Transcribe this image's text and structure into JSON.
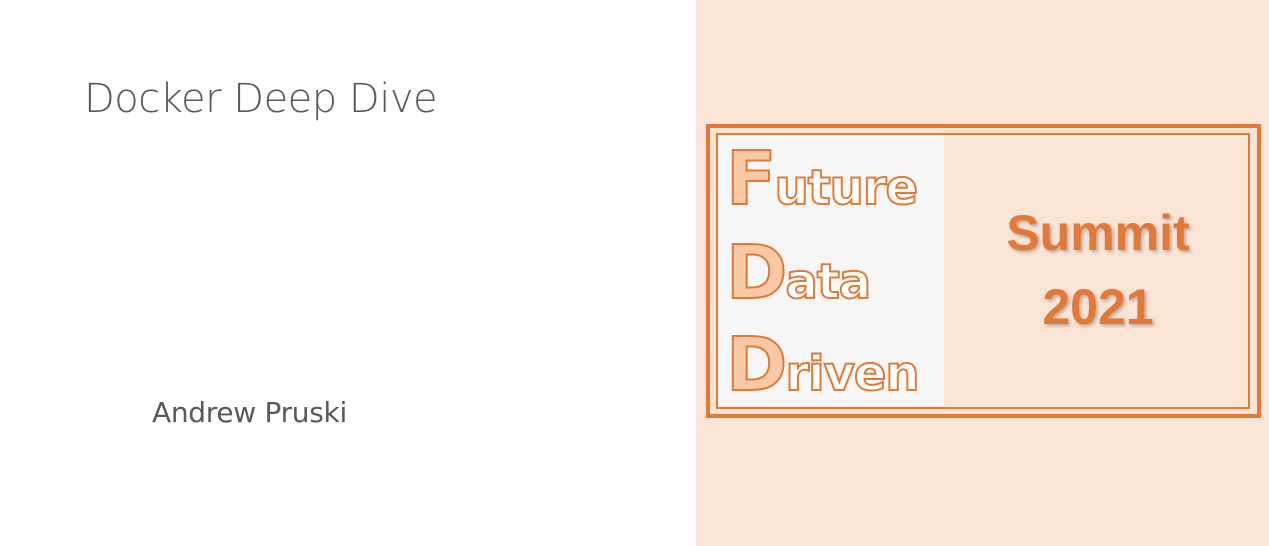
{
  "slide": {
    "title": "Docker Deep Dive",
    "author": "Andrew Pruski"
  },
  "logo": {
    "words": [
      {
        "cap": "F",
        "rest": "uture"
      },
      {
        "cap": "D",
        "rest": "ata"
      },
      {
        "cap": "D",
        "rest": "riven"
      }
    ],
    "summit_line1": "Summit",
    "summit_line2": "2021"
  },
  "colors": {
    "accent": "#e07a36",
    "peach_background": "#fae4d6",
    "cap_fill": "#f9c9a6",
    "text_gray": "#595959"
  }
}
